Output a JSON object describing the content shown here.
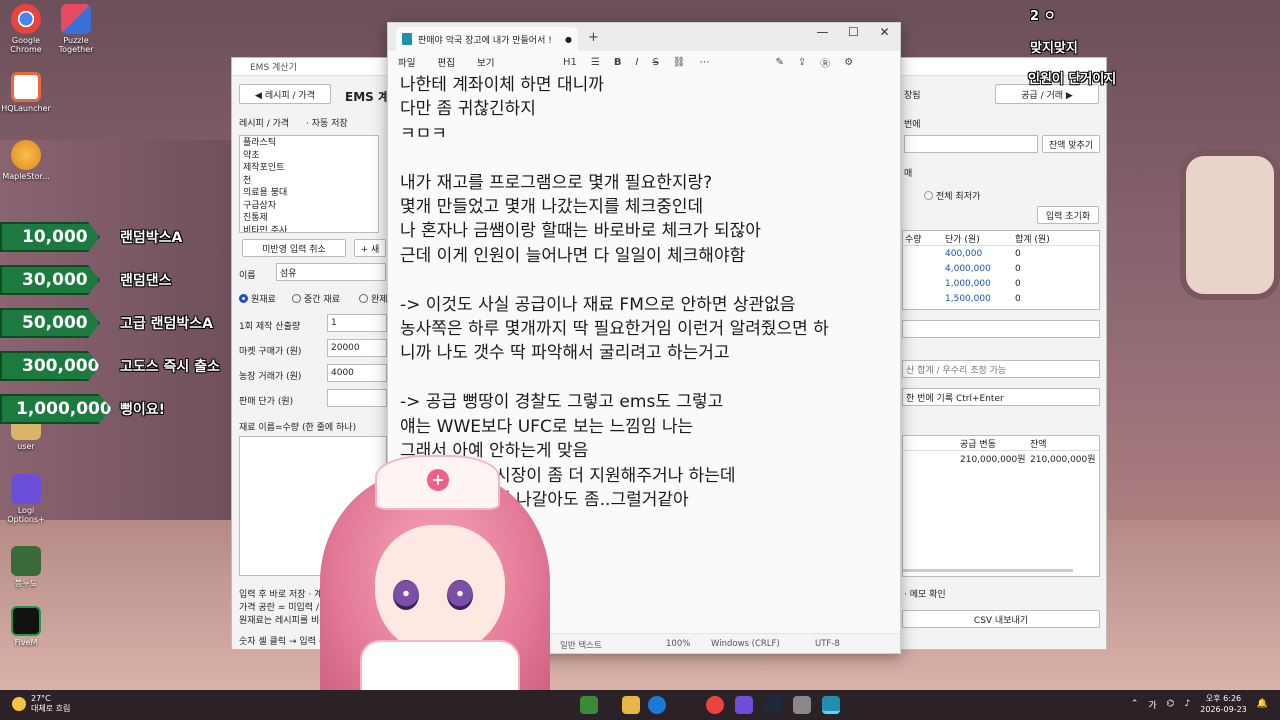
{
  "desktop": {
    "icons": [
      {
        "label": "Google Chrome",
        "icon": "chrome-icon",
        "color": "#e8453c"
      },
      {
        "label": "Puzzle Together",
        "icon": "puzzle-icon",
        "color": "#3b6fd4"
      },
      {
        "label": "HQLauncher",
        "icon": "hq-launcher-icon",
        "color": "#e86a3c"
      },
      {
        "label": "MapleStor...",
        "icon": "maplestory-icon",
        "color": "#f0a020"
      },
      {
        "label": "user",
        "icon": "user-folder-icon",
        "color": "#d9b56a"
      },
      {
        "label": "Logi Options+",
        "icon": "logi-icon",
        "color": "#6b4fd8"
      },
      {
        "label": "봉누도",
        "icon": "game-icon",
        "color": "#3a6a3a"
      },
      {
        "label": "FiveM",
        "icon": "fivem-icon",
        "color": "#1a9a4a"
      }
    ]
  },
  "donations": [
    {
      "amount": "10,000",
      "label": "랜덤박스A"
    },
    {
      "amount": "30,000",
      "label": "랜덤댄스"
    },
    {
      "amount": "50,000",
      "label": "고급 랜덤박스A"
    },
    {
      "amount": "300,000",
      "label": "고도스 즉시 출소"
    },
    {
      "amount": "1,000,000",
      "label": "뻥이요!"
    }
  ],
  "overlay": {
    "line1": "2 ㅇ",
    "line2": "맞지맞지",
    "line3": "인원이 단거이지"
  },
  "ems": {
    "window_title": "EMS 계산기",
    "recipe_tab": "◀ 레시피 / 가격",
    "heading": "EMS 계",
    "recipe_label": "레시피 / 가격",
    "autosave": "· 자동 저장",
    "recipes": [
      "플라스틱",
      "약초",
      "제작포인트",
      "천",
      "의료용 붕대",
      "구급상자",
      "진통제",
      "비타민 주사"
    ],
    "cancel_button": "미반영 입력 취소",
    "new_button": "+ 새",
    "name_label": "이름",
    "name_value": "섬유",
    "radio_raw": "원재료",
    "radio_mid": "중간 재료",
    "radio_done": "완제",
    "qty_label": "1회 제작 산출량",
    "qty_value": "1",
    "market_label": "마켓 구매가 (원)",
    "market_value": "20000",
    "farm_label": "농장 거래가 (원)",
    "farm_value": "4000",
    "sell_label": "판매 단가 (원)",
    "materials_label": "재료 이름=수량  (한 줄에 하나)",
    "help1": "입력 후 바로 저장 · 계산에",
    "help2": "가격 공란 = 미입력 / 0 =",
    "help3": "원재료는 레시피를 비워 두",
    "footer": "숫자 셀 클릭 → 입력 →",
    "right_tab": "공급 / 거래 ▶",
    "r_label1": "장됨",
    "r_label2": "번에",
    "r_label3": "매",
    "stock_button": "잔액 맞추기",
    "lowest_label": "전체 최저가",
    "reset_button": "입력 초기화",
    "table_headers": [
      "수량",
      "단가 (원)",
      "합계 (원)"
    ],
    "table_rows": [
      {
        "price": "400,000",
        "sum": "0"
      },
      {
        "price": "4,000,000",
        "sum": "0"
      },
      {
        "price": "1,000,000",
        "sum": "0"
      },
      {
        "price": "1,500,000",
        "sum": "0"
      }
    ],
    "sum_hint": "산 합계 / 우수리 조정 가능",
    "record_hint": "한 번에 기록   Ctrl+Enter",
    "ledger_headers": [
      "공급 변동",
      "잔액"
    ],
    "ledger_row": [
      "210,000,000원",
      "210,000,000원"
    ],
    "memo_hint": "· 메모 확인",
    "csv_button": "CSV 내보내기"
  },
  "notepad": {
    "tab_title": "판매야 악국 장고에 내가 만들어서 !",
    "menu": [
      "파일",
      "편집",
      "보기"
    ],
    "heading_tool": "H1",
    "body": "나한테 계좌이체 하면 대니까\n다만 좀 귀찮긴하지\nㅋㅁㅋ\n\n내가 재고를 프로그램으로 몇개 필요한지랑?\n몇개 만들었고 몇개 나갔는지를 체크중인데\n나 혼자나 금쌤이랑 할때는 바로바로 체크가 되잖아\n근데 이게 인원이 늘어나면 다 일일이 체크해야함\n\n-> 이것도 사실 공급이나 재료 FM으로 안하면 상관없음\n농사쪽은 하루 몇개까지 딱 필요한거임 이런거 알려줬으면 하\n니까 나도 갯수 딱 파악해서 굴리려고 하는거고\n\n-> 공급 뻥땅이 경찰도 그렇고 ems도 그렇고\n얘는 WWE보다 UFC로 보는 느낌임 나는\n그래서 아예 안하는게 맞음\n     부족할때 시장이 좀 더 지원해주거나 하는데\n     고 뻥땅치면 나갈아도 좀..그럴거같아\n\n     은?",
    "status_format": "일반 텍스트",
    "status_zoom": "100%",
    "status_eol": "Windows (CRLF)",
    "status_enc": "UTF-8"
  },
  "taskbar": {
    "temp": "27°C",
    "weather": "대체로 흐림",
    "lang": "가",
    "time": "오후 6:26",
    "date": "2026-09-23"
  },
  "colors": {
    "donation_green": "#1c7a3e",
    "link_blue": "#1a4fc9"
  }
}
